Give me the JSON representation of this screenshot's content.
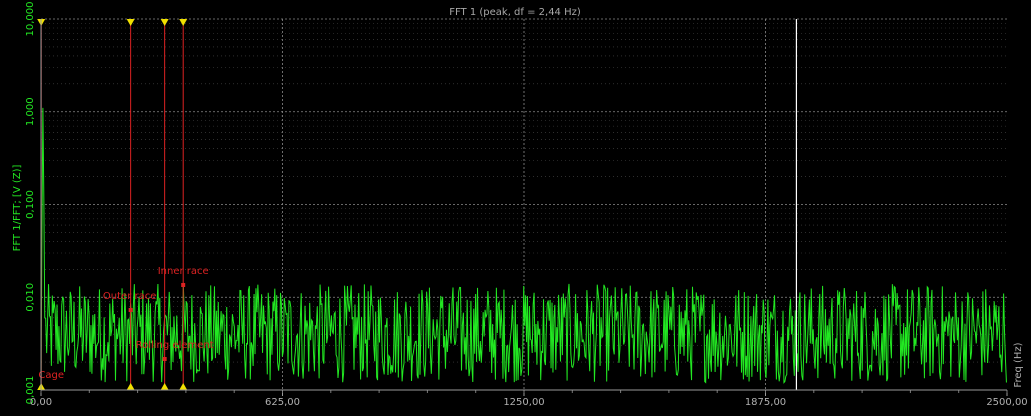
{
  "chart_data": {
    "type": "line",
    "title": "FFT 1 (peak, df = 2,44 Hz)",
    "ylabel": "FFT 1/FFT; [V (Z)]",
    "xlabel": "Freq (Hz)",
    "xlim": [
      0,
      2500
    ],
    "ylim": [
      0.001,
      10
    ],
    "y_scale": "log",
    "x_ticks": [
      {
        "value": 0,
        "label": "0,00"
      },
      {
        "value": 625,
        "label": "625,00"
      },
      {
        "value": 1250,
        "label": "1250,00"
      },
      {
        "value": 1875,
        "label": "1875,00"
      },
      {
        "value": 2500,
        "label": "2500,00"
      }
    ],
    "y_ticks": [
      {
        "value": 0.001,
        "label": "0,001"
      },
      {
        "value": 0.01,
        "label": "0,010"
      },
      {
        "value": 0.1,
        "label": "0,100"
      },
      {
        "value": 1,
        "label": "1,000"
      },
      {
        "value": 10,
        "label": "10,000"
      }
    ],
    "grid": true,
    "series": [
      {
        "color": "#22e822",
        "peaks": [
          {
            "x": 0.0,
            "y": 0.0012
          },
          {
            "x": 2.44,
            "y": 0.05
          },
          {
            "x": 4.88,
            "y": 1.1
          },
          {
            "x": 7.32,
            "y": 0.12
          },
          {
            "x": 9.76,
            "y": 0.006
          }
        ],
        "noise_floor": 0.004,
        "noise_min": 0.0012,
        "noise_max": 0.014,
        "df": 2.44
      }
    ],
    "markers": [
      {
        "name": "Cage",
        "x": 0.5
      },
      {
        "name": "Outer race",
        "x": 232
      },
      {
        "name": "Rolling element",
        "x": 320
      },
      {
        "name": "Inner race",
        "x": 368
      }
    ],
    "cursor_x": 1955,
    "colors": {
      "background": "#000000",
      "series": "#22e822",
      "marker": "#dd2222",
      "marker_triangle": "#f0e000",
      "axis_label": "#22e822",
      "text": "#b0b0b0",
      "grid": "#8a8a8a",
      "cursor": "#ffffff"
    }
  }
}
